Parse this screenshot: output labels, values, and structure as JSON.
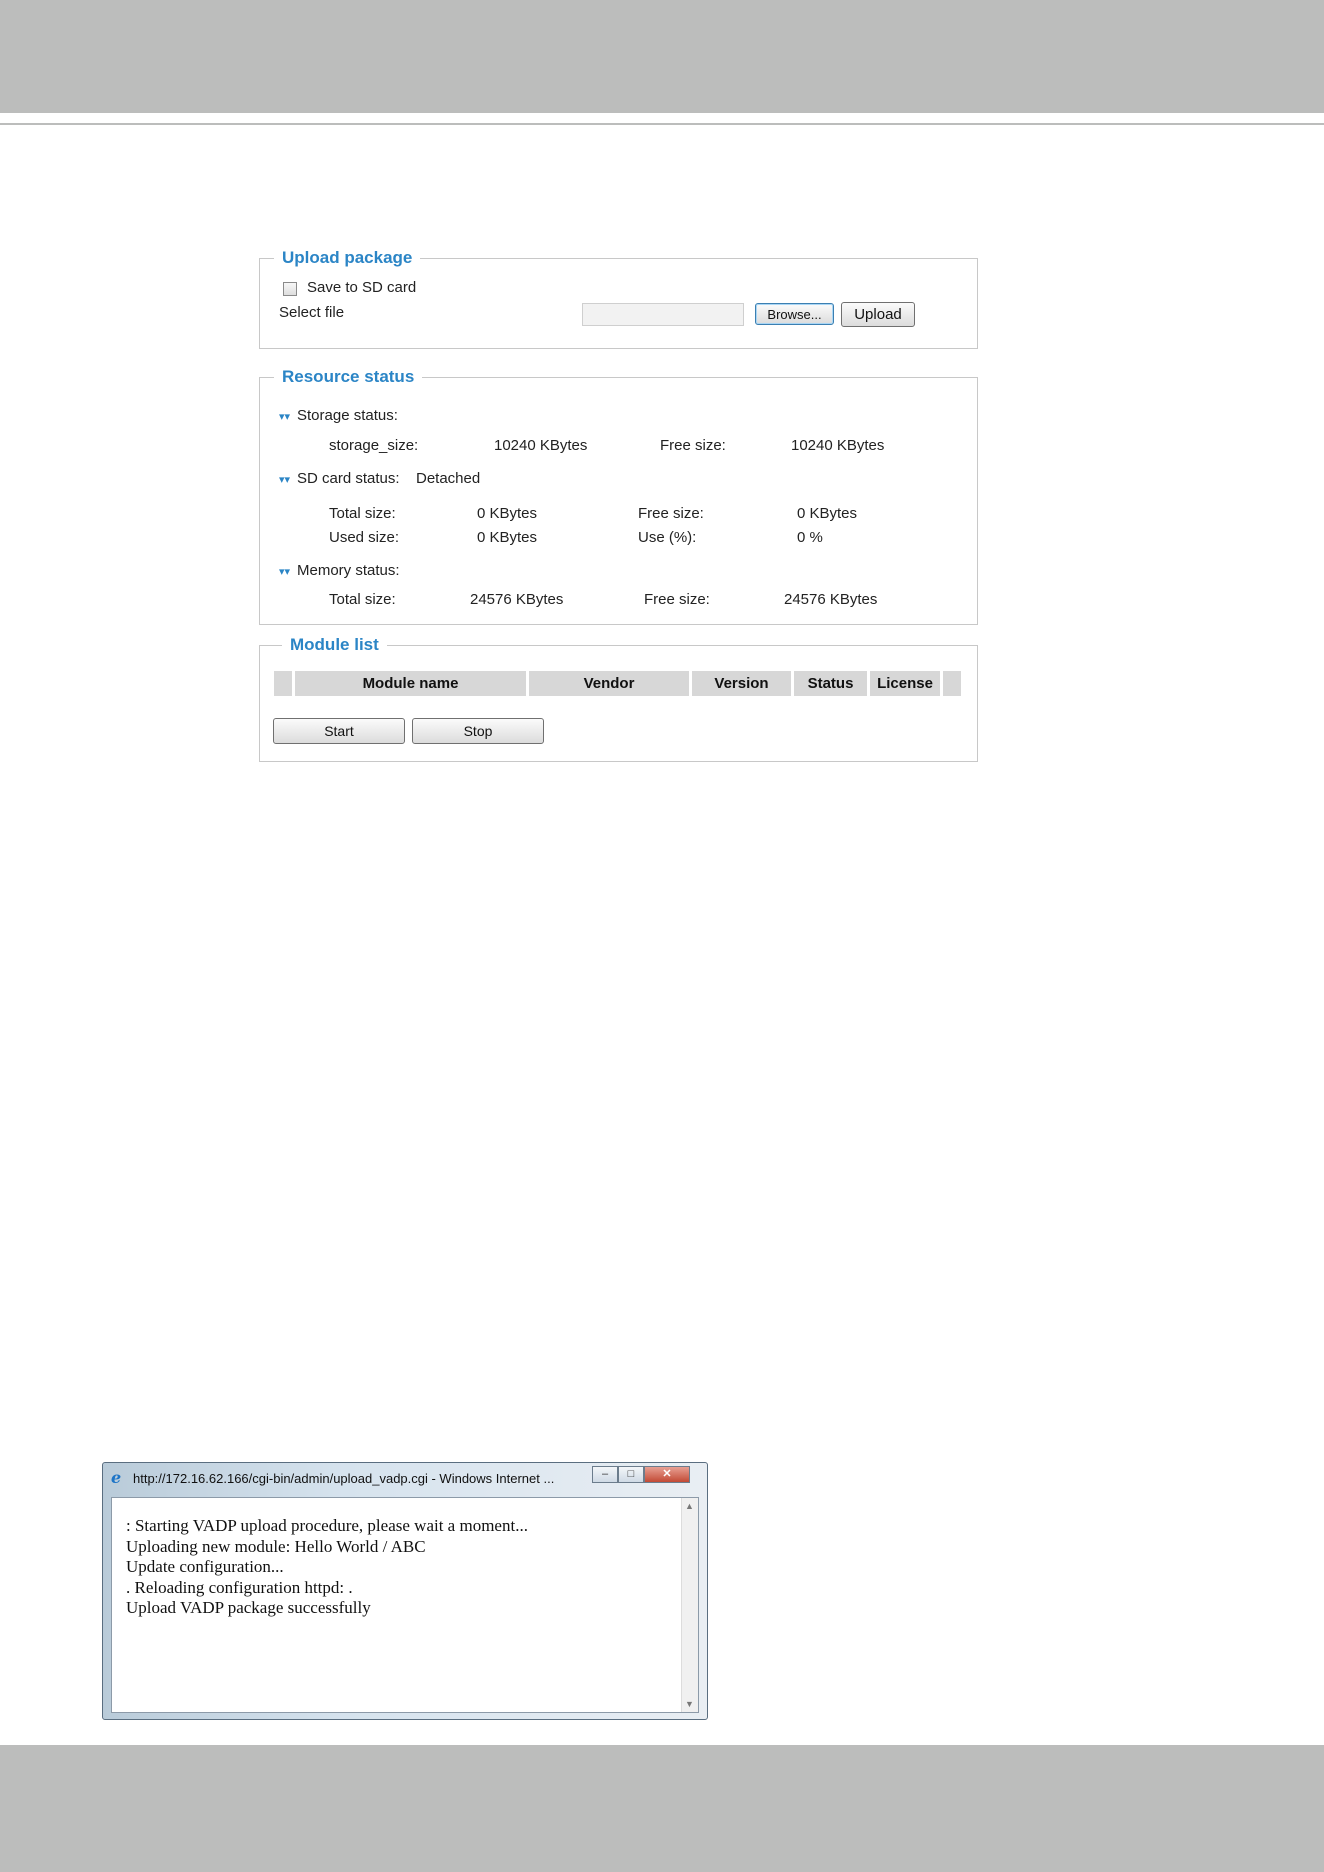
{
  "upload_package": {
    "legend": "Upload package",
    "save_to_sd_label": "Save to SD card",
    "select_file_label": "Select file",
    "browse_label": "Browse...",
    "upload_label": "Upload"
  },
  "resource_status": {
    "legend": "Resource status",
    "storage": {
      "heading": "Storage status:",
      "size_label": "storage_size:",
      "size_value": "10240  KBytes",
      "free_label": "Free size:",
      "free_value": "10240  KBytes"
    },
    "sd_card": {
      "heading": "SD card status:",
      "state": "Detached",
      "total_label": "Total size:",
      "total_value": "0  KBytes",
      "free_label": "Free size:",
      "free_value": "0  KBytes",
      "used_label": "Used size:",
      "used_value": "0  KBytes",
      "use_label": "Use (%):",
      "use_value": "0 %"
    },
    "memory": {
      "heading": "Memory status:",
      "total_label": "Total size:",
      "total_value": "24576  KBytes",
      "free_label": "Free size:",
      "free_value": "24576  KBytes"
    }
  },
  "module_list": {
    "legend": "Module list",
    "columns": [
      "Module name",
      "Vendor",
      "Version",
      "Status",
      "License"
    ],
    "start_label": "Start",
    "stop_label": "Stop"
  },
  "popup": {
    "title": "http://172.16.62.166/cgi-bin/admin/upload_vadp.cgi - Windows Internet ...",
    "lines": [
      ": Starting VADP upload procedure, please wait a moment...",
      "Uploading new module: Hello World / ABC",
      "Update configuration...",
      ". Reloading configuration httpd: .",
      "Upload VADP package successfully"
    ]
  }
}
